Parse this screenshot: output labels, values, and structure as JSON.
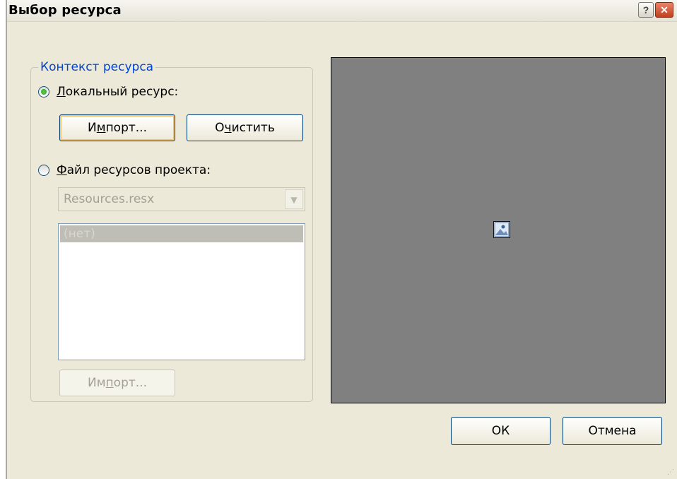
{
  "dialog": {
    "title": "Выбор ресурса"
  },
  "titlebar_buttons": {
    "help": "?",
    "close": "✕"
  },
  "context_group": {
    "legend": "Контекст ресурса",
    "local_resource": {
      "label_accel": "Л",
      "label_rest": "окальный ресурс:",
      "checked": true
    },
    "import_button": {
      "pre": "И",
      "accel": "м",
      "post": "порт..."
    },
    "clear_button": {
      "pre": "О",
      "accel": "ч",
      "post": "истить"
    },
    "project_resource": {
      "label_accel": "Ф",
      "label_rest": "айл ресурсов проекта:",
      "checked": false
    },
    "resource_file_select": {
      "value": "Resources.resx"
    },
    "resource_list": {
      "items": [
        "(нет)"
      ]
    },
    "project_import_button": {
      "pre": "Им",
      "accel": "п",
      "post": "орт..."
    }
  },
  "preview": {
    "icon": "image-placeholder-icon"
  },
  "footer": {
    "ok_label": "ОК",
    "cancel_label": "Отмена"
  },
  "colors": {
    "legend": "#0046d5",
    "preview_background": "#808080",
    "dialog_background": "#ece9d8"
  }
}
